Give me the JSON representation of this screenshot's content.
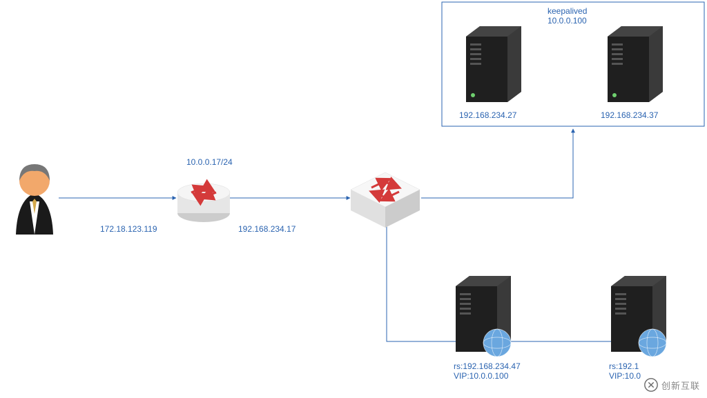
{
  "keepalived": {
    "title": "keepalived",
    "vip": "10.0.0.100",
    "server1_ip": "192.168.234.27",
    "server2_ip": "192.168.234.37"
  },
  "user": {
    "ip": "172.18.123.119"
  },
  "router": {
    "top_ip": "10.0.0.17/24",
    "right_ip": "192.168.234.17"
  },
  "realservers": {
    "rs1_line1": "rs:192.168.234.47",
    "rs1_line2": "VIP:10.0.0.100",
    "rs2_line1": "rs:192.1",
    "rs2_line2": "VIP:10.0"
  },
  "watermark": {
    "text": "创新互联"
  },
  "chart_data": {
    "type": "diagram",
    "title": "keepalived network topology",
    "nodes": [
      {
        "id": "user",
        "type": "client",
        "label": "172.18.123.119"
      },
      {
        "id": "router",
        "type": "router",
        "labels": [
          "10.0.0.17/24",
          "192.168.234.17"
        ]
      },
      {
        "id": "switch",
        "type": "switch"
      },
      {
        "id": "ka1",
        "type": "server",
        "group": "keepalived",
        "label": "192.168.234.27"
      },
      {
        "id": "ka2",
        "type": "server",
        "group": "keepalived",
        "label": "192.168.234.37"
      },
      {
        "id": "rs1",
        "type": "web-server",
        "labels": [
          "rs:192.168.234.47",
          "VIP:10.0.0.100"
        ]
      },
      {
        "id": "rs2",
        "type": "web-server",
        "labels": [
          "rs:192.1…",
          "VIP:10.0…"
        ]
      }
    ],
    "groups": [
      {
        "id": "keepalived",
        "title": "keepalived",
        "vip": "10.0.0.100",
        "members": [
          "ka1",
          "ka2"
        ]
      }
    ],
    "edges": [
      {
        "from": "user",
        "to": "router"
      },
      {
        "from": "router",
        "to": "switch"
      },
      {
        "from": "switch",
        "to": "keepalived-group"
      },
      {
        "from": "switch",
        "to": "rs1"
      },
      {
        "from": "switch",
        "to": "rs2"
      }
    ]
  }
}
